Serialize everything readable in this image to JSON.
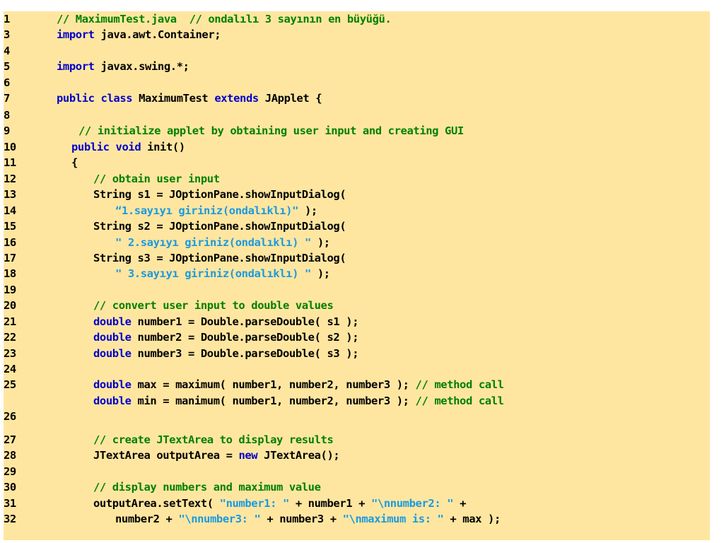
{
  "editor": {
    "colors": {
      "background": "#ffe6a0",
      "keyword": "#0000cc",
      "comment": "#008000",
      "string": "#1a9ae0",
      "text": "#000000"
    },
    "lines": [
      {
        "number": "1",
        "tokens": [
          [
            "cm",
            "// MaximumTest.java  // ondalılı 3 sayının en büyüğü."
          ]
        ]
      },
      {
        "number": "3",
        "tokens": [
          [
            "kw",
            "import"
          ],
          [
            "tx",
            " java.awt.Container;"
          ]
        ]
      },
      {
        "number": "4",
        "tokens": []
      },
      {
        "number": "5",
        "tokens": [
          [
            "kw",
            "import"
          ],
          [
            "tx",
            " javax.swing.*;"
          ]
        ]
      },
      {
        "number": "6",
        "tokens": []
      },
      {
        "number": "7",
        "tokens": [
          [
            "kw",
            "public class"
          ],
          [
            "tx",
            " MaximumTest "
          ],
          [
            "kw",
            "extends"
          ],
          [
            "tx",
            " JApplet {"
          ]
        ]
      },
      {
        "number": "8",
        "tokens": []
      },
      {
        "number": "9",
        "tokens": [
          [
            "cm",
            "// initialize applet by obtaining user input and creating GUI"
          ]
        ]
      },
      {
        "number": "10",
        "tokens": [
          [
            "kw",
            "public void"
          ],
          [
            "tx",
            " init()"
          ]
        ]
      },
      {
        "number": "11",
        "tokens": [
          [
            "tx",
            "{"
          ]
        ]
      },
      {
        "number": "12",
        "tokens": [
          [
            "cm",
            "// obtain user input"
          ]
        ]
      },
      {
        "number": "13",
        "tokens": [
          [
            "tx",
            "String s1 = JOptionPane.showInputDialog("
          ]
        ]
      },
      {
        "number": "14",
        "tokens": [
          [
            "st",
            "“1.sayıyı giriniz(ondalıklı)\""
          ],
          [
            "tx",
            " );"
          ]
        ]
      },
      {
        "number": "15",
        "tokens": [
          [
            "tx",
            "String s2 = JOptionPane.showInputDialog("
          ]
        ]
      },
      {
        "number": "16",
        "tokens": [
          [
            "st",
            "\" 2.sayıyı giriniz(ondalıklı) \""
          ],
          [
            "tx",
            " );"
          ]
        ]
      },
      {
        "number": "17",
        "tokens": [
          [
            "tx",
            "String s3 = JOptionPane.showInputDialog("
          ]
        ]
      },
      {
        "number": "18",
        "tokens": [
          [
            "st",
            "\" 3.sayıyı giriniz(ondalıklı) \""
          ],
          [
            "tx",
            " );"
          ]
        ]
      },
      {
        "number": "19",
        "tokens": []
      },
      {
        "number": "20",
        "tokens": [
          [
            "cm",
            "// convert user input to double values"
          ]
        ]
      },
      {
        "number": "21",
        "tokens": [
          [
            "kw",
            "double"
          ],
          [
            "tx",
            " number1 = Double.parseDouble( s1 );"
          ]
        ]
      },
      {
        "number": "22",
        "tokens": [
          [
            "kw",
            "double"
          ],
          [
            "tx",
            " number2 = Double.parseDouble( s2 );"
          ]
        ]
      },
      {
        "number": "23",
        "tokens": [
          [
            "kw",
            "double"
          ],
          [
            "tx",
            " number3 = Double.parseDouble( s3 );"
          ]
        ]
      },
      {
        "number": "24",
        "tokens": []
      },
      {
        "number": "25",
        "tokens": [
          [
            "kw",
            "double"
          ],
          [
            "tx",
            " max = maximum( number1, number2, number3 ); "
          ],
          [
            "cm",
            "// method call"
          ]
        ]
      },
      {
        "number": "",
        "tokens": [
          [
            "kw",
            "double"
          ],
          [
            "tx",
            " min = manimum( number1, number2, number3 ); "
          ],
          [
            "cm",
            "// method call"
          ]
        ]
      },
      {
        "number": "26",
        "tokens": []
      },
      {
        "number": "27",
        "tokens": [
          [
            "cm",
            "// create JTextArea to display results"
          ]
        ]
      },
      {
        "number": "28",
        "tokens": [
          [
            "tx",
            "JTextArea outputArea = "
          ],
          [
            "kw",
            "new"
          ],
          [
            "tx",
            " JTextArea();"
          ]
        ]
      },
      {
        "number": "29",
        "tokens": []
      },
      {
        "number": "30",
        "tokens": [
          [
            "cm",
            "// display numbers and maximum value"
          ]
        ]
      },
      {
        "number": "31",
        "tokens": [
          [
            "tx",
            "outputArea.setText( "
          ],
          [
            "st",
            "\"number1: \""
          ],
          [
            "tx",
            " + number1 + "
          ],
          [
            "st",
            "\"\\nnumber2: \""
          ],
          [
            "tx",
            " +"
          ]
        ]
      },
      {
        "number": "32",
        "tokens": [
          [
            "tx",
            "number2 + "
          ],
          [
            "st",
            "\"\\nnumber3: \""
          ],
          [
            "tx",
            " + number3 + "
          ],
          [
            "st",
            "\"\\nmaximum is: \""
          ],
          [
            "tx",
            " + max );"
          ]
        ]
      }
    ]
  }
}
